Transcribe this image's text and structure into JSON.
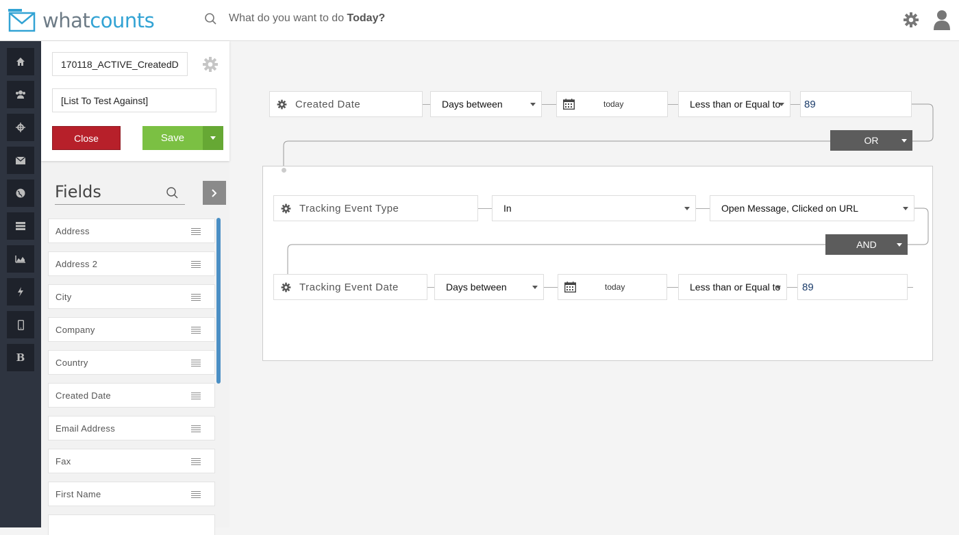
{
  "header": {
    "logo_prefix": "what",
    "logo_suffix": "counts",
    "search_prompt": "What do you want to do ",
    "search_prompt_bold": "Today?",
    "icons": [
      "search-icon",
      "gear-icon",
      "user-icon"
    ]
  },
  "rail": {
    "items": [
      {
        "name": "home",
        "icon": "home-icon"
      },
      {
        "name": "users",
        "icon": "users-icon"
      },
      {
        "name": "target",
        "icon": "crosshair-icon"
      },
      {
        "name": "mail",
        "icon": "envelope-icon"
      },
      {
        "name": "globe",
        "icon": "globe-icon"
      },
      {
        "name": "list",
        "icon": "list-icon"
      },
      {
        "name": "chart",
        "icon": "area-chart-icon"
      },
      {
        "name": "flash",
        "icon": "bolt-icon"
      },
      {
        "name": "mobile",
        "icon": "mobile-icon"
      },
      {
        "name": "bold",
        "icon": "b-icon",
        "glyph": "B"
      }
    ]
  },
  "panel": {
    "segment_name": "170118_ACTIVE_CreatedD",
    "test_list": "[List To Test Against]",
    "close_label": "Close",
    "save_label": "Save",
    "fields_title": "Fields",
    "fields": [
      "Address",
      "Address 2",
      "City",
      "Company",
      "Country",
      "Created Date",
      "Email Address",
      "Fax",
      "First Name"
    ]
  },
  "rules": {
    "row1": {
      "field": "Created Date",
      "operator": "Days between",
      "date": "today",
      "comparison": "Less than or Equal to",
      "value": "89"
    },
    "logic1": "OR",
    "row2": {
      "field": "Tracking Event Type",
      "operator": "In",
      "value": "Open Message, Clicked on URL"
    },
    "logic2": "AND",
    "row3": {
      "field": "Tracking Event Date",
      "operator": "Days between",
      "date": "today",
      "comparison": "Less than or Equal to",
      "value": "89"
    }
  },
  "colors": {
    "brand_blue": "#32a3d4",
    "close_red": "#b7202a",
    "save_green": "#7bc043",
    "rail_dark": "#2e3440",
    "logic_gray": "#5c5c5c",
    "scroll_blue": "#4b8fc4"
  }
}
